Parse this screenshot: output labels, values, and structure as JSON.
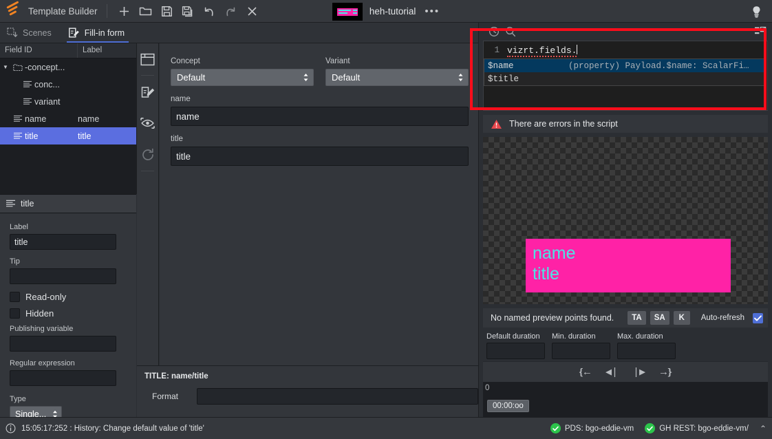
{
  "topbar": {
    "app_title": "Template Builder",
    "logo_icon": "vizrt-swoosh-logo",
    "buttons": [
      {
        "name": "new",
        "icon": "plus-icon"
      },
      {
        "name": "open",
        "icon": "folder-open-icon"
      },
      {
        "name": "save",
        "icon": "save-disk-icon"
      },
      {
        "name": "save-as",
        "icon": "save-as-disk-icon"
      },
      {
        "name": "undo",
        "icon": "undo-arrow-icon"
      },
      {
        "name": "redo",
        "icon": "redo-arrow-icon"
      },
      {
        "name": "close",
        "icon": "close-x-icon"
      }
    ],
    "document_name": "heh-tutorial",
    "overflow": "•••",
    "hint_icon": "lightbulb-icon"
  },
  "tabs": [
    {
      "label": "Scenes",
      "icon": "scenes-icon",
      "active": false
    },
    {
      "label": "Fill-in form",
      "icon": "form-edit-icon",
      "active": true
    }
  ],
  "tree": {
    "columns": [
      "Field ID",
      "Label"
    ],
    "rows": [
      {
        "id": "-concept...",
        "label": "",
        "icon": "folder-icon",
        "depth": 0,
        "expanded": true,
        "selected": false
      },
      {
        "id": "conc...",
        "label": "",
        "icon": "field-lines-icon",
        "depth": 1,
        "selected": false
      },
      {
        "id": "variant",
        "label": "",
        "icon": "field-lines-icon",
        "depth": 1,
        "selected": false
      },
      {
        "id": "name",
        "label": "name",
        "icon": "field-lines-icon",
        "depth": 0,
        "selected": false
      },
      {
        "id": "title",
        "label": "title",
        "icon": "field-lines-icon",
        "depth": 0,
        "selected": true
      }
    ]
  },
  "properties": {
    "header": "title",
    "header_icon": "field-lines-icon",
    "label_caption": "Label",
    "label_value": "title",
    "tip_caption": "Tip",
    "tip_value": "",
    "readonly_caption": "Read-only",
    "readonly_checked": false,
    "hidden_caption": "Hidden",
    "hidden_checked": false,
    "pubvar_caption": "Publishing variable",
    "pubvar_value": "",
    "regex_caption": "Regular expression",
    "regex_value": "",
    "type_caption": "Type",
    "type_value": "Single..."
  },
  "rail": [
    {
      "name": "panel-layout",
      "icon": "window-panel-icon",
      "enabled": true
    },
    {
      "name": "edit-form",
      "icon": "pencil-edit-icon",
      "enabled": true
    },
    {
      "name": "preview-eye",
      "icon": "eye-preview-icon",
      "enabled": true
    },
    {
      "name": "refresh",
      "icon": "refresh-circular-icon",
      "enabled": false
    }
  ],
  "form": {
    "concept_label": "Concept",
    "concept_value": "Default",
    "variant_label": "Variant",
    "variant_value": "Default",
    "fields": [
      {
        "label": "name",
        "value": "name"
      },
      {
        "label": "title",
        "value": "title"
      }
    ]
  },
  "title_section": {
    "heading": "TITLE: name/title",
    "format_label": "Format",
    "format_value": ""
  },
  "script": {
    "tool_icons": [
      "history-clock-icon",
      "search-magnifier-icon"
    ],
    "maximize_icon": "maximize-panel-icon",
    "line_number": "1",
    "code": "vizrt.fields.",
    "autocomplete": [
      {
        "name": "$name",
        "detail": "(property) Payload.$name: ScalarFi…",
        "selected": true
      },
      {
        "name": "$title",
        "detail": "",
        "selected": false
      }
    ],
    "error_message": "There are errors in the script",
    "error_icon": "warning-triangle-icon"
  },
  "preview": {
    "card_lines": [
      "name",
      "title"
    ],
    "card_bg": "#ff22a6",
    "text_color": "#4de3e3",
    "status_message": "No named preview points found.",
    "buttons": [
      "TA",
      "SA",
      "K"
    ],
    "autorefresh_label": "Auto-refresh",
    "autorefresh_checked": true,
    "durations": [
      {
        "label": "Default duration",
        "value": ""
      },
      {
        "label": "Min. duration",
        "value": ""
      },
      {
        "label": "Max. duration",
        "value": ""
      }
    ],
    "transport": [
      {
        "name": "jump-start",
        "glyph": "❴←"
      },
      {
        "name": "step-back",
        "glyph": "◀|"
      },
      {
        "name": "step-forward",
        "glyph": "|▶"
      },
      {
        "name": "jump-end",
        "glyph": "→❵"
      }
    ],
    "timeline_zero": "0",
    "timecode": "00:00:oo"
  },
  "status": {
    "info_icon": "info-circle-icon",
    "message": "15:05:17:252 : History: Change default value of 'title'",
    "connections": [
      {
        "label": "PDS: bgo-eddie-vm",
        "ok": true
      },
      {
        "label": "GH REST: bgo-eddie-vm/",
        "ok": true
      }
    ],
    "collapse_icon": "chevron-up-icon"
  }
}
